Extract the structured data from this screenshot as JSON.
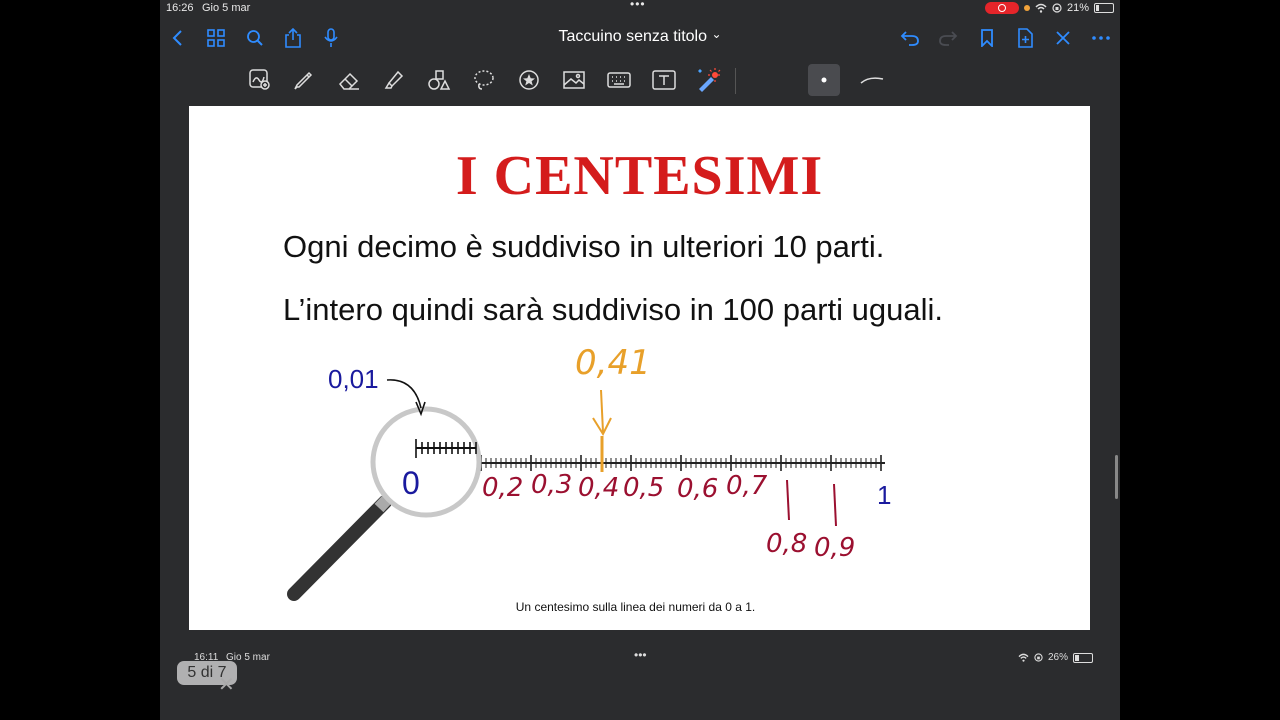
{
  "status_bar": {
    "time": "16:26",
    "date": "Gio 5 mar",
    "battery": "21%",
    "battery_level": 0.21
  },
  "nav": {
    "title": "Taccuino senza titolo",
    "title_chevron": "⌄"
  },
  "nav_icons": [
    "back-icon",
    "grid-icon",
    "search-icon",
    "share-icon",
    "mic-icon",
    "undo-icon",
    "redo-icon",
    "bookmark-icon",
    "add-page-icon",
    "close-icon",
    "more-icon"
  ],
  "tools": [
    "scan-icon",
    "pen-icon",
    "eraser-icon",
    "highlighter-icon",
    "shapes-icon",
    "lasso-icon",
    "sticker-icon",
    "image-icon",
    "keyboard-icon",
    "text-icon",
    "laser-pointer-icon"
  ],
  "slide": {
    "title": "I CENTESIMI",
    "line1": "Ogni decimo è suddiviso in ulteriori 10 parti.",
    "line2": "L’intero quindi sarà suddiviso in 100 parti uguali.",
    "magnifier_label": "0,01",
    "zero_label": "0",
    "one_label": "1",
    "handwritten_top": "0,41",
    "handwritten_labels": [
      "0,2",
      "0,3",
      "0,4",
      "0,5",
      "0,6",
      "0,7",
      "0,8",
      "0,9"
    ],
    "caption": "Un centesimo sulla linea dei numeri da 0 a 1."
  },
  "colors": {
    "title_red": "#d41c1c",
    "number_blue": "#1a1a9e",
    "ink_red": "#9b1030",
    "ink_orange": "#e8a02a",
    "accent_blue": "#2f8cff"
  },
  "bottom_status": {
    "time": "16:11",
    "date": "Gio 5 mar",
    "battery": "26%",
    "battery_level": 0.26
  },
  "page_indicator": "5 di 7"
}
